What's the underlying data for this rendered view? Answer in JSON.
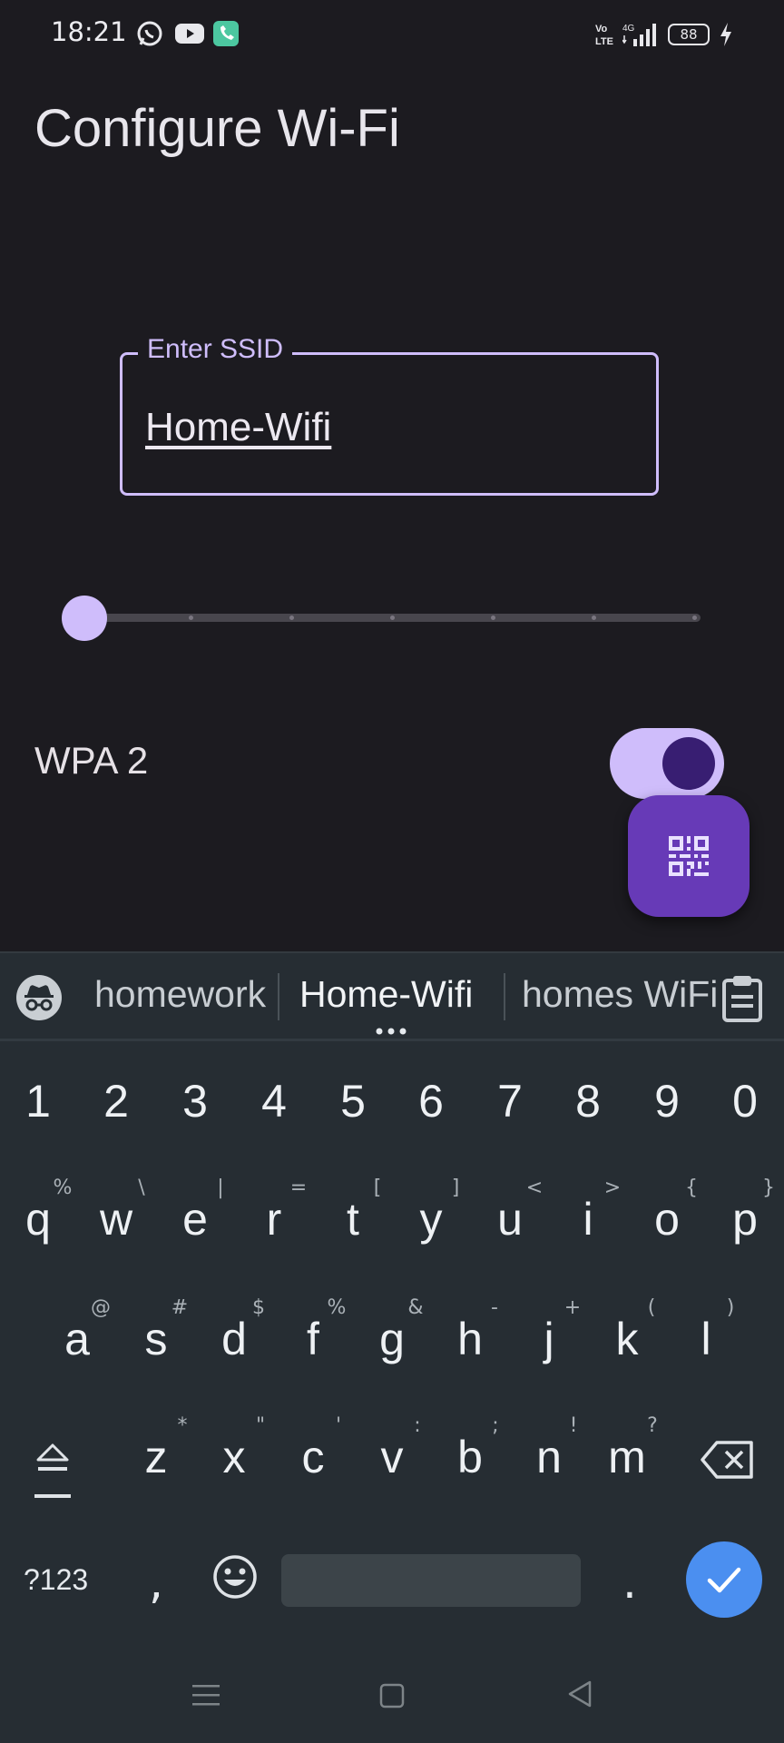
{
  "status_bar": {
    "time": "18:21",
    "left_icons": [
      "whatsapp-icon",
      "youtube-icon",
      "phone-icon"
    ],
    "network": "4G",
    "volte": "Vo LTE",
    "battery": "88"
  },
  "page": {
    "title": "Configure Wi-Fi"
  },
  "ssid": {
    "label": "Enter SSID",
    "value": "Home-Wifi"
  },
  "slider": {
    "steps": 7,
    "value_index": 0
  },
  "security": {
    "label": "WPA 2",
    "enabled": true
  },
  "fab": {
    "icon": "qr-code-icon"
  },
  "keyboard": {
    "suggestions": [
      "homework",
      "Home-Wifi",
      "homes WiFi"
    ],
    "number_row": [
      "1",
      "2",
      "3",
      "4",
      "5",
      "6",
      "7",
      "8",
      "9",
      "0"
    ],
    "row1": [
      "q",
      "w",
      "e",
      "r",
      "t",
      "y",
      "u",
      "i",
      "o",
      "p"
    ],
    "row1_hints": [
      "%",
      "\\",
      "|",
      "=",
      "[",
      "]",
      "<",
      ">",
      "{",
      "}"
    ],
    "row2": [
      "a",
      "s",
      "d",
      "f",
      "g",
      "h",
      "j",
      "k",
      "l"
    ],
    "row2_hints": [
      "@",
      "#",
      "$",
      "%",
      "&",
      "-",
      "+",
      "(",
      ")"
    ],
    "row3": [
      "z",
      "x",
      "c",
      "v",
      "b",
      "n",
      "m"
    ],
    "row3_hints": [
      "*",
      "\"",
      "'",
      ":",
      ";",
      "!",
      "?"
    ],
    "symbols_label": "?123",
    "comma": ",",
    "period": "."
  },
  "colors": {
    "background": "#1c1b20",
    "accent": "#cfbdfb",
    "fab": "#673ab7",
    "keyboard_bg": "#262d33",
    "enter_key": "#4b8ff0"
  }
}
